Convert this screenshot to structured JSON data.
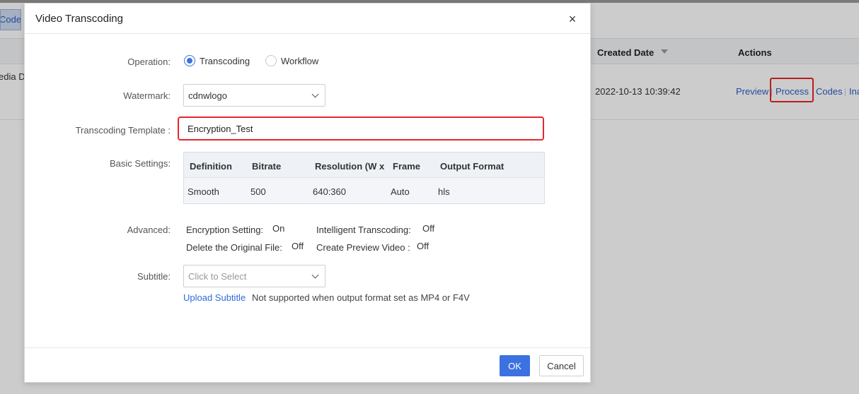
{
  "background": {
    "code_button_label": "Code",
    "table_headers": {
      "created_date": "Created Date",
      "actions": "Actions"
    },
    "row": {
      "media_partial": "edia D",
      "created_date": "2022-10-13 10:39:42",
      "actions": {
        "preview": "Preview",
        "process": "Process",
        "codes": "Codes",
        "partial": "Ina"
      },
      "separator": "|"
    }
  },
  "modal": {
    "title": "Video Transcoding",
    "close_glyph": "×",
    "operation": {
      "label": "Operation:",
      "options": [
        "Transcoding",
        "Workflow"
      ],
      "selected": "Transcoding"
    },
    "watermark": {
      "label": "Watermark:",
      "value": "cdnwlogo"
    },
    "transcoding_template": {
      "label": "Transcoding Template :",
      "value": "Encryption_Test"
    },
    "basic_settings": {
      "label": "Basic Settings:",
      "columns": [
        "Definition",
        "Bitrate",
        "Resolution (W x",
        "Frame",
        "Output Format"
      ],
      "rows": [
        [
          "Smooth",
          "500",
          "640:360",
          "Auto",
          "hls"
        ]
      ]
    },
    "advanced": {
      "label": "Advanced:",
      "items": [
        {
          "key": "Encryption Setting:",
          "value": "On"
        },
        {
          "key": "Intelligent Transcoding:",
          "value": "Off"
        },
        {
          "key": "Delete the Original File:",
          "value": "Off"
        },
        {
          "key": "Create Preview Video :",
          "value": "Off"
        }
      ]
    },
    "subtitle": {
      "label": "Subtitle:",
      "placeholder": "Click to Select",
      "upload_link": "Upload Subtitle",
      "note": "Not supported when output format set as MP4 or F4V"
    },
    "footer": {
      "ok_label": "OK",
      "cancel_label": "Cancel"
    }
  },
  "colors": {
    "accent": "#3b72e0",
    "link": "#2d5ec4",
    "highlight": "#e8252a"
  }
}
